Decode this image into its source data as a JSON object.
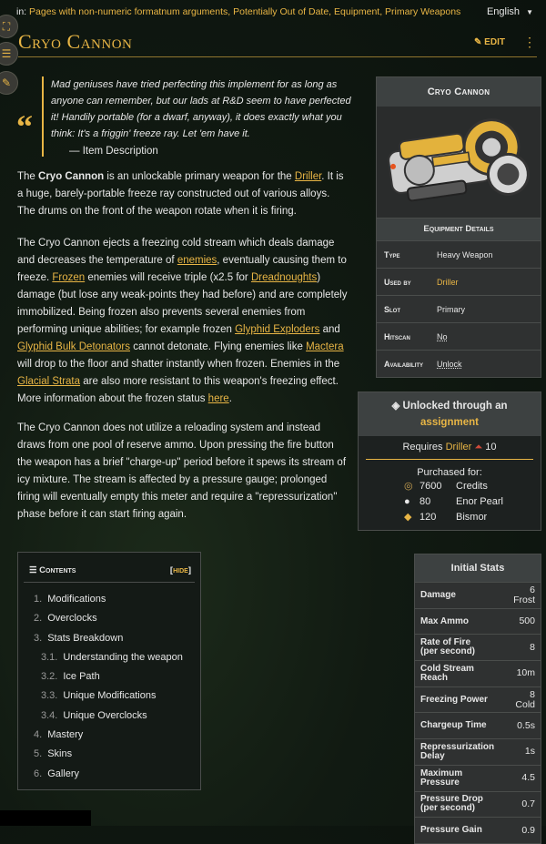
{
  "topbar": {
    "cats_label": "in:",
    "categories": "Pages with non-numeric formatnum arguments, Potentially Out of Date, Equipment, Primary Weapons",
    "language": "English"
  },
  "page": {
    "title": "Cryo Cannon",
    "edit_label": "EDIT"
  },
  "quote": {
    "text": "Mad geniuses have tried perfecting this implement for as long as anyone can remember, but our lads at R&D seem to have perfected it! Handily portable (for a dwarf, anyway), it does exactly what you think: It's a friggin' freeze ray. Let 'em have it.",
    "cite": "— Item Description"
  },
  "para1": {
    "a": "The ",
    "name": "Cryo Cannon",
    "b": " is an unlockable primary weapon for the ",
    "driller": "Driller",
    "c": ". It is a huge, barely-portable freeze ray constructed out of various alloys. The drums on the front of the weapon rotate when it is firing."
  },
  "para2": {
    "a": "The Cryo Cannon ejects a freezing cold stream which deals damage and decreases the temperature of ",
    "enemies": "enemies",
    "b": ", eventually causing them to freeze. ",
    "frozen": "Frozen",
    "c": " enemies will receive triple (x2.5 for ",
    "dread": "Dreadnoughts",
    "d": ") damage (but lose any weak-points they had before) and are completely immobilized. Being frozen also prevents several enemies from performing unique abilities; for example frozen ",
    "exploders": "Glyphid Exploders",
    "e": " and ",
    "bulk": "Glyphid Bulk Detonators",
    "f": " cannot detonate. Flying enemies like ",
    "mactera": "Mactera",
    "g": " will drop to the floor and shatter instantly when frozen. Enemies in the ",
    "glacial": "Glacial Strata",
    "h": " are also more resistant to this weapon's freezing effect. More information about the frozen status ",
    "here": "here",
    "i": "."
  },
  "para3": "The Cryo Cannon does not utilize a reloading system and instead draws from one pool of reserve ammo. Upon pressing the fire button the weapon has a brief \"charge-up\" period before it spews its stream of icy mixture. The stream is affected by a pressure gauge; prolonged firing will eventually empty this meter and require a \"repressurization\" phase before it can start firing again.",
  "infobox": {
    "title": "Cryo Cannon",
    "subheader": "Equipment Details",
    "rows": [
      {
        "k": "Type",
        "v": "Heavy Weapon"
      },
      {
        "k": "Used by",
        "v": "Driller"
      },
      {
        "k": "Slot",
        "v": "Primary"
      },
      {
        "k": "Hitscan",
        "v": "No"
      },
      {
        "k": "Availability",
        "v": "Unlock"
      }
    ]
  },
  "unlock": {
    "head_a": "Unlocked through an",
    "head_b": "assignment",
    "req_label": "Requires",
    "req_class": "Driller",
    "req_level": "10",
    "purchased": "Purchased for:",
    "costs": [
      {
        "amount": "7600",
        "name": "Credits",
        "icon": "credits-icon"
      },
      {
        "amount": "80",
        "name": "Enor Pearl",
        "icon": "enor-pearl-icon"
      },
      {
        "amount": "120",
        "name": "Bismor",
        "icon": "bismor-icon"
      }
    ]
  },
  "toc": {
    "title": "Contents",
    "hide": "hide",
    "items": [
      {
        "num": "1.",
        "label": "Modifications"
      },
      {
        "num": "2.",
        "label": "Overclocks"
      },
      {
        "num": "3.",
        "label": "Stats Breakdown"
      },
      {
        "num": "3.1.",
        "label": "Understanding the weapon"
      },
      {
        "num": "3.2.",
        "label": "Ice Path"
      },
      {
        "num": "3.3.",
        "label": "Unique Modifications"
      },
      {
        "num": "3.4.",
        "label": "Unique Overclocks"
      },
      {
        "num": "4.",
        "label": "Mastery"
      },
      {
        "num": "5.",
        "label": "Skins"
      },
      {
        "num": "6.",
        "label": "Gallery"
      }
    ]
  },
  "stats": {
    "title": "Initial Stats",
    "rows": [
      {
        "k": "Damage",
        "v": "6",
        "v2": "Frost"
      },
      {
        "k": "Max Ammo",
        "v": "500"
      },
      {
        "k": "Rate of Fire",
        "k2": "(per second)",
        "v": "8"
      },
      {
        "k": "Cold Stream",
        "k2": "Reach",
        "v": "10m"
      },
      {
        "k": "Freezing Power",
        "v": "8",
        "v2": "Cold"
      },
      {
        "k": "Chargeup Time",
        "v": "0.5s"
      },
      {
        "k": "Repressurization",
        "k2": "Delay",
        "v": "1s"
      },
      {
        "k": "Maximum",
        "k2": "Pressure",
        "v": "4.5"
      },
      {
        "k": "Pressure Drop",
        "k2": "(per second)",
        "v": "0.7"
      },
      {
        "k": "Pressure Gain",
        "v": "0.9"
      }
    ]
  }
}
